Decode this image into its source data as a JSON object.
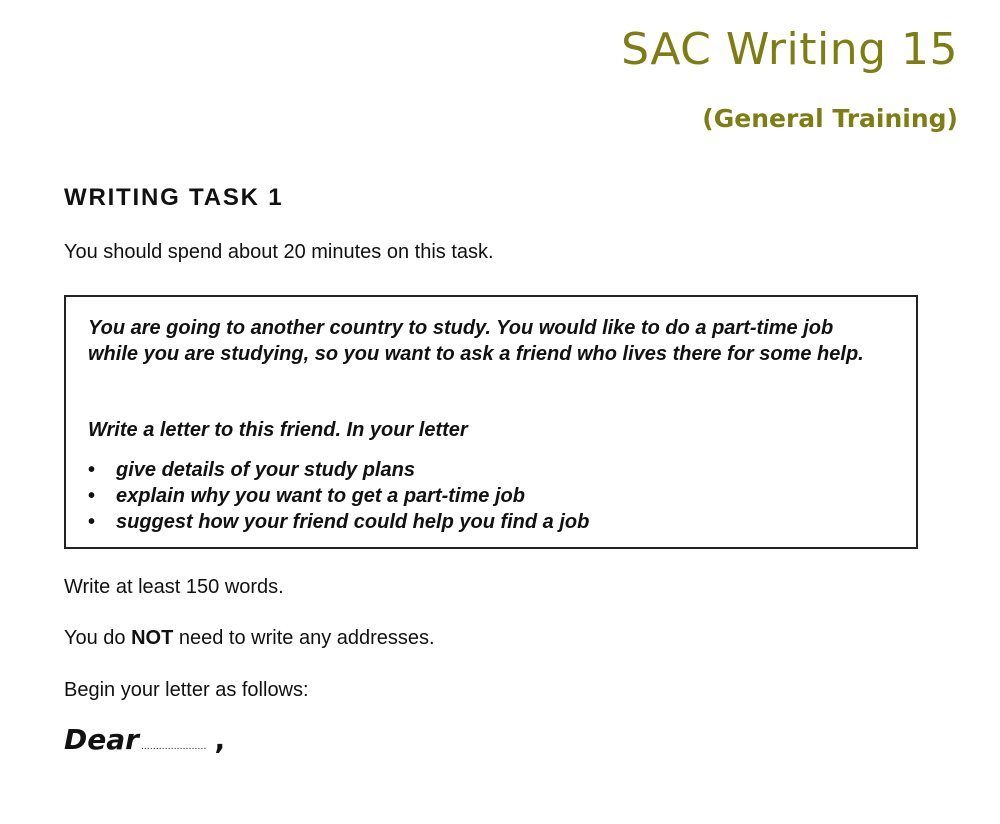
{
  "header": {
    "title": "SAC Writing 15",
    "subtitle": "(General Training)"
  },
  "task": {
    "heading": "WRITING TASK 1",
    "time_instruction": "You should spend about 20 minutes on this task.",
    "box": {
      "prompt": "You are going to another country to study. You would like to do a part-time job while you are studying, so you want to ask a friend who lives there for some help.",
      "letter_intro": "Write a letter to this friend. In your letter",
      "bullet_symbol": "•",
      "bullets": [
        "give details of your study plans",
        "explain why you want to get a part-time job",
        "suggest how your friend could help you find a job"
      ]
    },
    "word_instruction": "Write at least 150 words.",
    "address_instruction": {
      "before": "You do ",
      "emphasis": "NOT",
      "after": " need to write any addresses."
    },
    "begin_instruction": "Begin your letter as follows:",
    "greeting": {
      "word": "Dear",
      "dots": "......................",
      "comma": ","
    }
  }
}
